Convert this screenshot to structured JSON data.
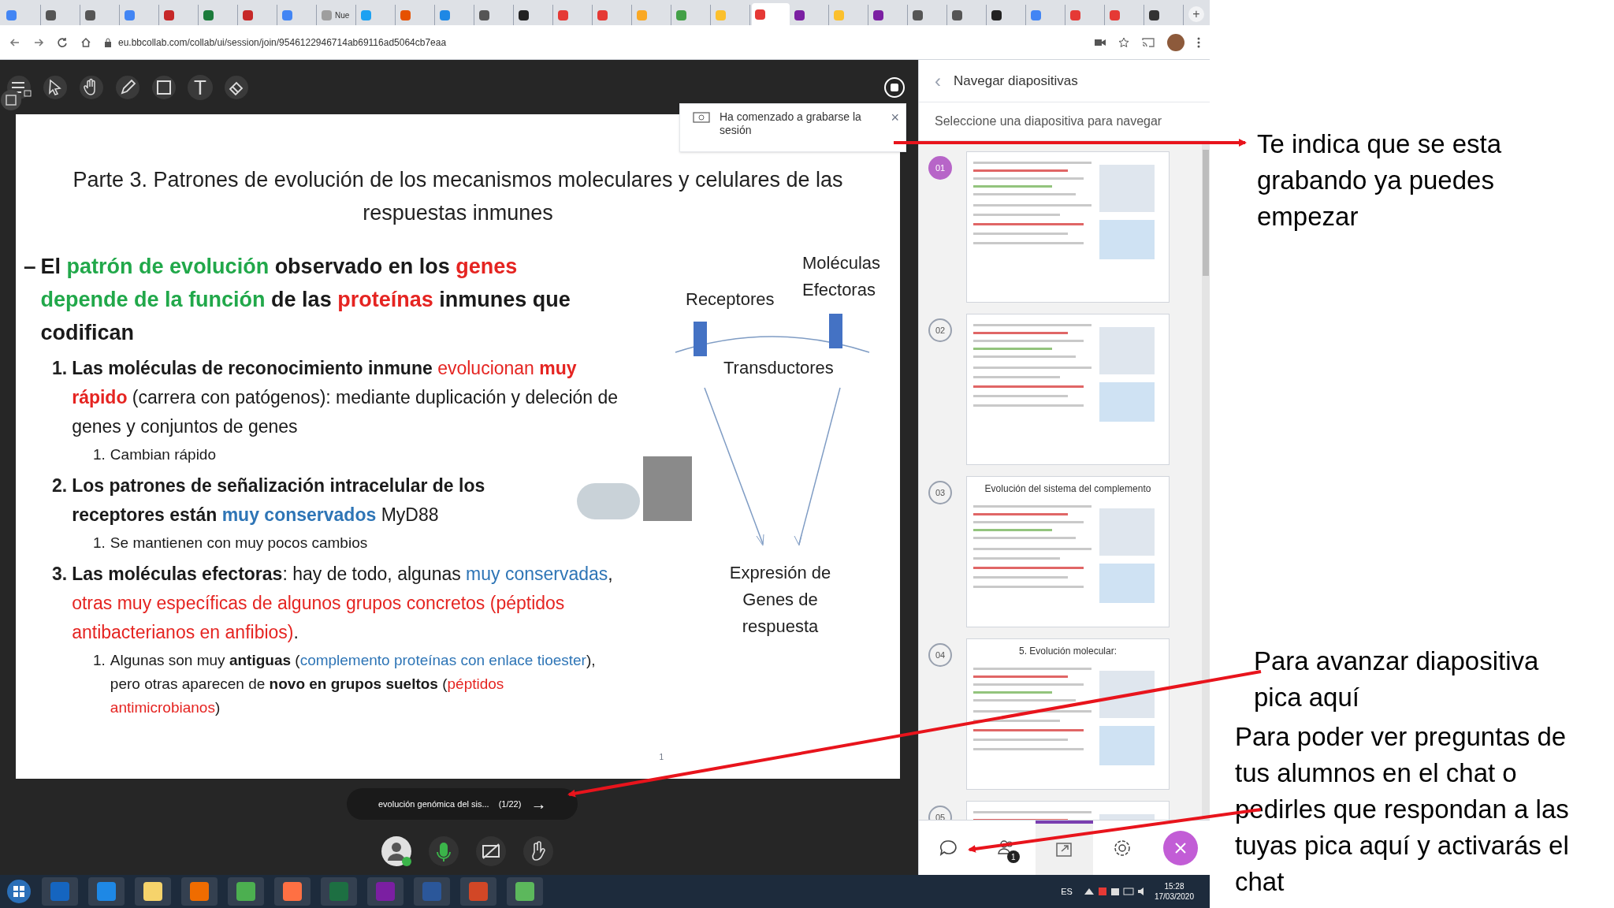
{
  "browser": {
    "tabs": [
      {
        "color": "#4285f4",
        "selected": false
      },
      {
        "color": "#555555",
        "selected": false
      },
      {
        "color": "#555555",
        "selected": false
      },
      {
        "color": "#4285f4",
        "selected": false
      },
      {
        "color": "#c62828",
        "selected": false
      },
      {
        "color": "#1b7a3a",
        "selected": false
      },
      {
        "color": "#c62828",
        "selected": false
      },
      {
        "color": "#4285f4",
        "selected": false
      },
      {
        "color": "#9e9e9e",
        "selected": false,
        "label": "Nue"
      },
      {
        "color": "#1da1f2",
        "selected": false
      },
      {
        "color": "#e65100",
        "selected": false
      },
      {
        "color": "#1e88e5",
        "selected": false
      },
      {
        "color": "#555555",
        "selected": false
      },
      {
        "color": "#222222",
        "selected": false
      },
      {
        "color": "#e53935",
        "selected": false
      },
      {
        "color": "#e53935",
        "selected": false
      },
      {
        "color": "#f9a825",
        "selected": false
      },
      {
        "color": "#43a047",
        "selected": false
      },
      {
        "color": "#fbc02d",
        "selected": false
      },
      {
        "color": "#e53935",
        "selected": true
      },
      {
        "color": "#7b1fa2",
        "selected": false
      },
      {
        "color": "#fbc02d",
        "selected": false
      },
      {
        "color": "#7b1fa2",
        "selected": false
      },
      {
        "color": "#555555",
        "selected": false
      },
      {
        "color": "#555555",
        "selected": false
      },
      {
        "color": "#222222",
        "selected": false
      },
      {
        "color": "#4285f4",
        "selected": false
      },
      {
        "color": "#e53935",
        "selected": false
      },
      {
        "color": "#e53935",
        "selected": false
      },
      {
        "color": "#333333",
        "selected": false
      }
    ],
    "new_tab": "+",
    "url": "eu.bbcollab.com/collab/ui/session/join/9546122946714ab69116ad5064cb7eaa"
  },
  "toolbar": {
    "tools": [
      {
        "kind": "menu"
      },
      {
        "kind": "pointer"
      },
      {
        "kind": "hand"
      },
      {
        "kind": "pencil"
      },
      {
        "kind": "shape"
      },
      {
        "kind": "text",
        "glyph": "T"
      },
      {
        "kind": "eraser"
      }
    ]
  },
  "recording_toast": {
    "message": "Ha comenzado a grabarse la sesión",
    "close": "×"
  },
  "slide": {
    "title": "Parte 3. Patrones de evolución de los mecanismos moleculares y celulares de las respuestas inmunes",
    "bullet": {
      "marker": "–",
      "segments": [
        {
          "text": "El ",
          "bold": true,
          "color": "#1a1a1a"
        },
        {
          "text": "patrón de evolución",
          "bold": true,
          "color": "#21a84a"
        },
        {
          "text": " observado en los ",
          "bold": true,
          "color": "#1a1a1a"
        },
        {
          "text": "genes",
          "bold": true,
          "color": "#e52421"
        },
        {
          "text": " depende de la función",
          "bold": true,
          "color": "#21a84a"
        },
        {
          "text": " de las ",
          "bold": true,
          "color": "#1a1a1a"
        },
        {
          "text": "proteínas",
          "bold": true,
          "color": "#e52421"
        },
        {
          "text": " inmunes que codifican",
          "bold": true,
          "color": "#1a1a1a"
        }
      ],
      "items": [
        {
          "number": "1.",
          "segments": [
            {
              "text": "Las moléculas de reconocimiento inmune ",
              "bold": true,
              "color": "#1a1a1a"
            },
            {
              "text": "evolucionan ",
              "bold": false,
              "color": "#e52421"
            },
            {
              "text": "muy rápido",
              "bold": true,
              "color": "#e52421"
            },
            {
              "text": " (carrera con patógenos): mediante duplicación y deleción de genes y conjuntos de genes",
              "bold": false,
              "color": "#1a1a1a"
            }
          ],
          "children": [
            {
              "number": "1.",
              "segments": [
                {
                  "text": "Cambian rápido",
                  "bold": false,
                  "color": "#1a1a1a"
                }
              ]
            }
          ]
        },
        {
          "number": "2.",
          "segments": [
            {
              "text": "Los patrones de señalización intracelular de los receptores están ",
              "bold": true,
              "color": "#1a1a1a"
            },
            {
              "text": "muy conservados",
              "bold": true,
              "color": "#2e75b6"
            },
            {
              "text": "  MyD88",
              "bold": false,
              "color": "#1a1a1a"
            }
          ],
          "children": [
            {
              "number": "1.",
              "segments": [
                {
                  "text": "Se mantienen con muy pocos cambios",
                  "bold": false,
                  "color": "#1a1a1a"
                }
              ]
            }
          ]
        },
        {
          "number": "3.",
          "segments": [
            {
              "text": "Las moléculas efectoras",
              "bold": true,
              "color": "#1a1a1a"
            },
            {
              "text": ": hay de todo, algunas ",
              "bold": false,
              "color": "#1a1a1a"
            },
            {
              "text": "muy conservadas",
              "bold": false,
              "color": "#2e75b6"
            },
            {
              "text": ", ",
              "bold": false
            },
            {
              "text": "otras muy específicas de algunos grupos concretos (péptidos antibacterianos en anfibios)",
              "bold": false,
              "color": "#e52421"
            },
            {
              "text": ".",
              "bold": false
            }
          ],
          "children": [
            {
              "number": "1.",
              "segments": [
                {
                  "text": "Algunas son muy ",
                  "bold": false,
                  "color": "#1a1a1a"
                },
                {
                  "text": "antiguas",
                  "bold": true,
                  "color": "#1a1a1a"
                },
                {
                  "text": " (",
                  "bold": false,
                  "color": "#1a1a1a"
                },
                {
                  "text": "complemento proteínas con enlace tioester",
                  "bold": false,
                  "color": "#2e75b6"
                },
                {
                  "text": "), pero otras aparecen de ",
                  "bold": false,
                  "color": "#1a1a1a"
                },
                {
                  "text": "novo en grupos sueltos",
                  "bold": true,
                  "color": "#1a1a1a"
                },
                {
                  "text": " (",
                  "bold": false,
                  "color": "#1a1a1a"
                },
                {
                  "text": "péptidos antimicrobianos",
                  "bold": false,
                  "color": "#e52421"
                },
                {
                  "text": ")",
                  "bold": false,
                  "color": "#1a1a1a"
                }
              ]
            }
          ]
        }
      ]
    },
    "diagram": {
      "receptors": "Receptores",
      "effectors": "Moléculas Efectoras",
      "transducers": "Transductores",
      "output": "Expresión de Genes de respuesta"
    },
    "page_number": "1"
  },
  "slide_nav": {
    "label": "evolución genómica del sis...",
    "position": "(1/22)",
    "next": "→"
  },
  "session_controls": [
    {
      "kind": "avatar"
    },
    {
      "kind": "microphone"
    },
    {
      "kind": "camera"
    },
    {
      "kind": "hand"
    }
  ],
  "sidebar": {
    "title": "Navegar diapositivas",
    "back": "‹",
    "subtitle": "Seleccione una diapositiva para navegar",
    "slides": [
      {
        "number": "01",
        "selected": true
      },
      {
        "number": "02",
        "selected": false
      },
      {
        "number": "03",
        "selected": false,
        "title": "Evolución del sistema del complemento"
      },
      {
        "number": "04",
        "selected": false,
        "title": "5. Evolución molecular:"
      },
      {
        "number": "05",
        "selected": false
      }
    ],
    "bottom_tabs": [
      {
        "kind": "chat",
        "selected": false
      },
      {
        "kind": "participants",
        "selected": false,
        "badge": "1"
      },
      {
        "kind": "share",
        "selected": true
      },
      {
        "kind": "settings",
        "selected": false
      },
      {
        "kind": "close",
        "selected": false
      }
    ]
  },
  "taskbar": {
    "apps": [
      {
        "color": "#1565c0"
      },
      {
        "color": "#1e88e5"
      },
      {
        "color": "#f6d36b"
      },
      {
        "color": "#ef6c00"
      },
      {
        "color": "#4caf50"
      },
      {
        "color": "#ff7043"
      },
      {
        "color": "#1d6f42"
      },
      {
        "color": "#7b1fa2"
      },
      {
        "color": "#2b579a"
      },
      {
        "color": "#d24726"
      },
      {
        "color": "#5cb85c"
      }
    ],
    "language": "ES",
    "time": "15:28",
    "date": "17/03/2020"
  },
  "annotations": [
    {
      "text": "Te indica que se esta grabando ya puedes empezar"
    },
    {
      "text": "Para avanzar diapositiva pica aquí"
    },
    {
      "text": "Para poder ver preguntas de tus alumnos en el chat o pedirles que respondan a las tuyas pica aquí y activarás el chat"
    }
  ]
}
